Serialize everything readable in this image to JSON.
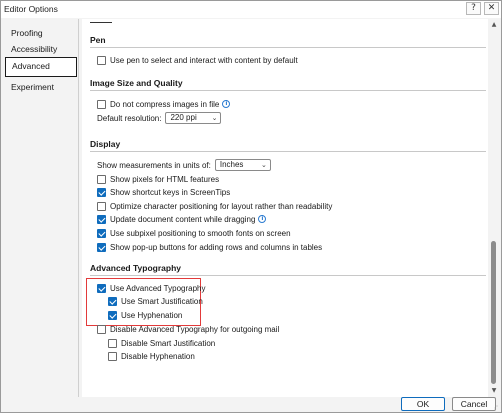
{
  "window": {
    "title": "Editor Options",
    "help_label": "?",
    "close_label": "✕"
  },
  "sidebar": {
    "items": [
      {
        "label": "Proofing"
      },
      {
        "label": "Accessibility"
      },
      {
        "label": "Advanced"
      },
      {
        "label": "Experiment"
      }
    ],
    "active": "Advanced"
  },
  "sections": {
    "pen": {
      "title": "Pen",
      "options": [
        {
          "label": "Use pen to select and interact with content by default",
          "checked": false
        }
      ]
    },
    "image": {
      "title": "Image Size and Quality",
      "dont_compress": {
        "label": "Do not compress images in file",
        "checked": false
      },
      "resolution_label": "Default resolution:",
      "resolution_value": "220 ppi"
    },
    "display": {
      "title": "Display",
      "units_label": "Show measurements in units of:",
      "units_value": "Inches",
      "options": [
        {
          "label": "Show pixels for HTML features",
          "checked": false
        },
        {
          "label": "Show shortcut keys in ScreenTips",
          "checked": true
        },
        {
          "label": "Optimize character positioning for layout rather than readability",
          "checked": false
        },
        {
          "label": "Update document content while dragging",
          "checked": true
        },
        {
          "label": "Use subpixel positioning to smooth fonts on screen",
          "checked": true
        },
        {
          "label": "Show pop-up buttons for adding rows and columns in tables",
          "checked": true
        }
      ]
    },
    "typography": {
      "title": "Advanced Typography",
      "options": [
        {
          "label": "Use Advanced Typography",
          "checked": true
        },
        {
          "label": "Use Smart Justification",
          "checked": true
        },
        {
          "label": "Use Hyphenation",
          "checked": true
        },
        {
          "label": "Disable Advanced Typography for outgoing mail",
          "checked": false
        },
        {
          "label": "Disable Smart Justification",
          "checked": false
        },
        {
          "label": "Disable Hyphenation",
          "checked": false
        }
      ]
    }
  },
  "footer": {
    "ok_label": "OK",
    "cancel_label": "Cancel"
  },
  "colors": {
    "accent": "#0f6cbd",
    "highlight": "#e23a3a"
  }
}
